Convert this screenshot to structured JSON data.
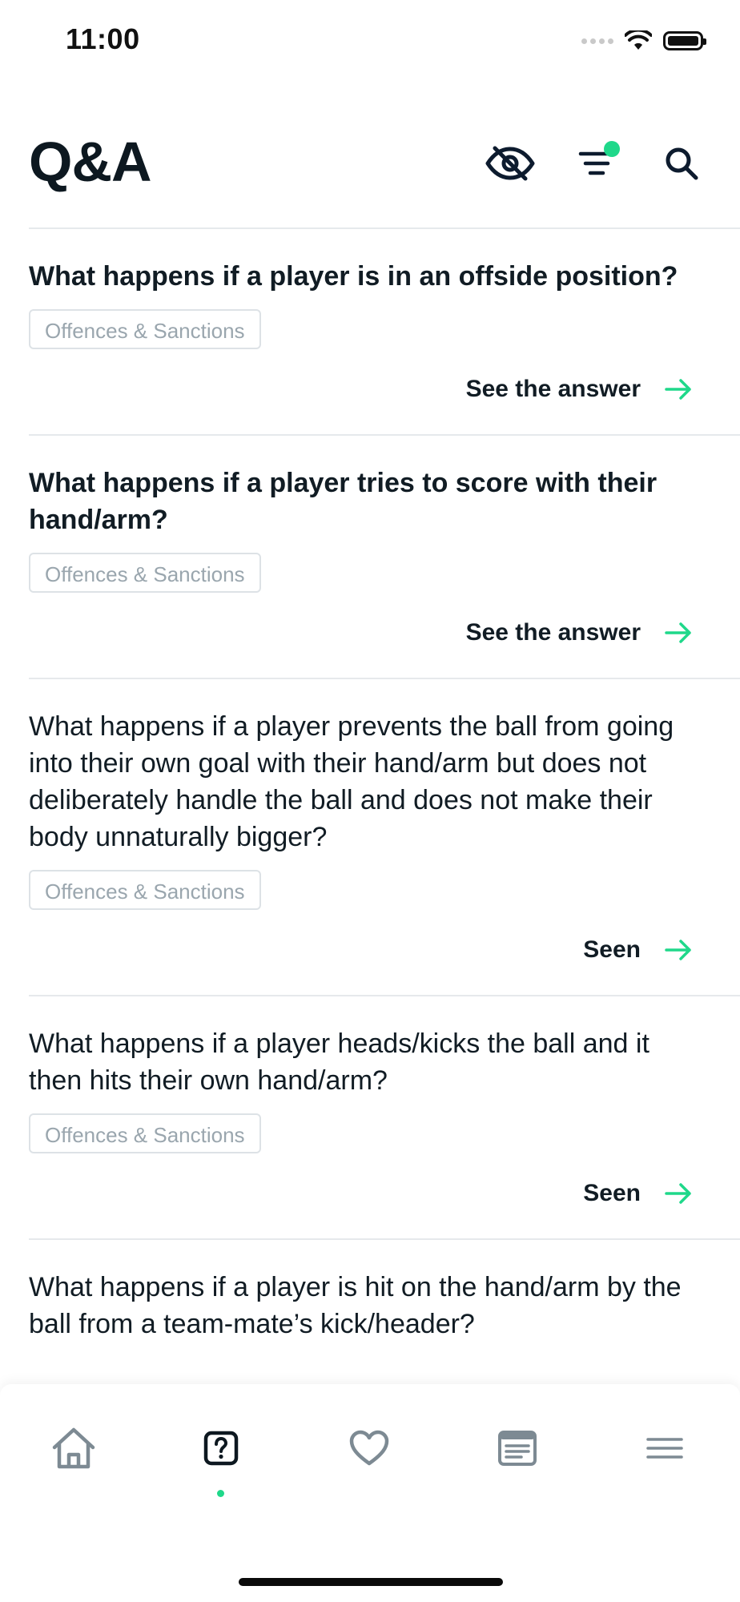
{
  "status_bar": {
    "time": "11:00"
  },
  "header": {
    "title": "Q&A"
  },
  "qa_items": [
    {
      "question": "What happens if a player is in an offside position?",
      "tag": "Offences & Sanctions",
      "action": "See the answer",
      "read": false
    },
    {
      "question": "What happens if a player tries to score with their hand/arm?",
      "tag": "Offences & Sanctions",
      "action": "See the answer",
      "read": false
    },
    {
      "question": "What happens if a player prevents the ball from going into their own goal with their hand/arm but does not deliberately handle the ball and does not make their body unnaturally bigger?",
      "tag": "Offences & Sanctions",
      "action": "Seen",
      "read": true
    },
    {
      "question": "What happens if a player heads/kicks the ball and it then hits their own hand/arm?",
      "tag": "Offences & Sanctions",
      "action": "Seen",
      "read": true
    },
    {
      "question": "What happens if a player is hit on the hand/arm by the ball from a team-mate’s kick/header?",
      "read": true
    }
  ],
  "colors": {
    "accent": "#1fd88a",
    "text": "#0f1a22",
    "muted": "#9aa6ae",
    "divider": "#e6e9ec",
    "tab_icon": "#7d8a93"
  },
  "icons": {
    "header": [
      "eye-slash-icon",
      "filter-icon",
      "search-icon"
    ],
    "tabs": [
      "home-icon",
      "question-icon",
      "heart-icon",
      "news-icon",
      "menu-icon"
    ],
    "action": "arrow-right-icon"
  },
  "tabs": {
    "active": "question"
  }
}
